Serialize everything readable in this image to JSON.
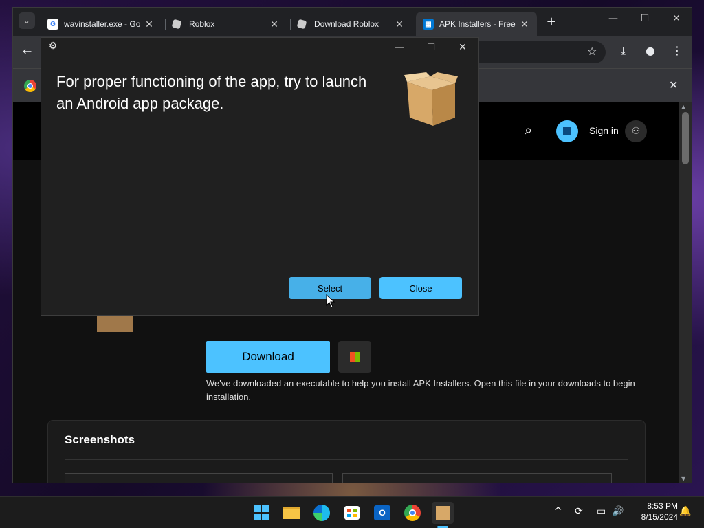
{
  "browser": {
    "tabs": [
      {
        "label": "wavinstaller.exe - Go",
        "close": "✕",
        "active": false
      },
      {
        "label": "Roblox",
        "close": "✕",
        "active": false
      },
      {
        "label": "Download Roblox",
        "close": "✕",
        "active": false
      },
      {
        "label": "APK Installers - Free",
        "close": "✕",
        "active": true
      }
    ],
    "new_tab": "+",
    "window_controls": {
      "minimize": "—",
      "maximize": "☐",
      "close": "✕"
    },
    "toolbar_icons": [
      "back-arrow-icon",
      "star-icon",
      "download-icon",
      "profile-icon",
      "more-icon"
    ]
  },
  "site": {
    "header": {
      "sign_in_label": "Sign in"
    },
    "download_label": "Download",
    "note": "We've downloaded an executable to help you install APK Installers. Open this file in your downloads to begin installation.",
    "screenshots_heading": "Screenshots"
  },
  "dialog": {
    "message": "For proper functioning of the app, try to launch an Android app package.",
    "select_label": "Select",
    "close_label": "Close",
    "controls": {
      "minimize": "—",
      "maximize": "☐",
      "close": "✕"
    }
  },
  "taskbar": {
    "apps": [
      "start-icon",
      "file-explorer-icon",
      "edge-icon",
      "store-icon",
      "outlook-icon",
      "chrome-icon",
      "package-icon"
    ],
    "time": "8:53 PM",
    "date": "8/15/2024"
  },
  "colors": {
    "accent": "#4cc2ff",
    "dialog_bg": "#202020",
    "browser_bg": "#202124",
    "taskbar_bg": "#1c1c1c"
  }
}
